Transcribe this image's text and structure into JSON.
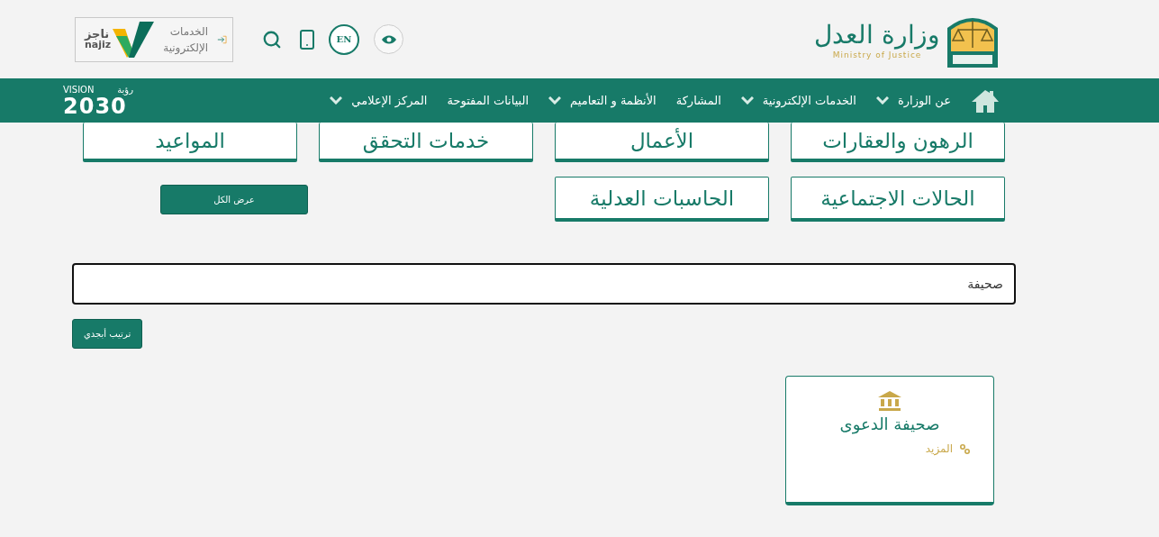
{
  "header": {
    "ministry_logo": {
      "arabic": "وزارة العدل",
      "english": "Ministry of Justice"
    },
    "language_button": "EN",
    "najiz": {
      "label": "الخدمات الإلكترونية",
      "arabic": "ناجز",
      "latin": "najiz"
    }
  },
  "nav": {
    "items": [
      {
        "label": "عن الوزارة",
        "dropdown": true
      },
      {
        "label": "الخدمات الإلكترونية",
        "dropdown": true
      },
      {
        "label": "المشاركة",
        "dropdown": false
      },
      {
        "label": "الأنظمة و التعاميم",
        "dropdown": true
      },
      {
        "label": "البيانات المفتوحة",
        "dropdown": false
      },
      {
        "label": "المركز الإعلامي",
        "dropdown": true
      }
    ],
    "vision_logo": {
      "word": "VISION",
      "arabic": "رؤية",
      "year": "2030"
    }
  },
  "categories": [
    [
      "الرهون والعقارات",
      "الأعمال",
      "خدمات التحقق",
      "المواعيد"
    ],
    [
      "الحالات الاجتماعية",
      "الحاسبات العدلية"
    ]
  ],
  "view_all_button": "عرض الكل",
  "search": {
    "value": "صحيفة"
  },
  "sort_button": "ترتيب أبجدي",
  "cards": [
    {
      "title": "صحيفة الدعوى",
      "link": "المزيد"
    }
  ]
}
